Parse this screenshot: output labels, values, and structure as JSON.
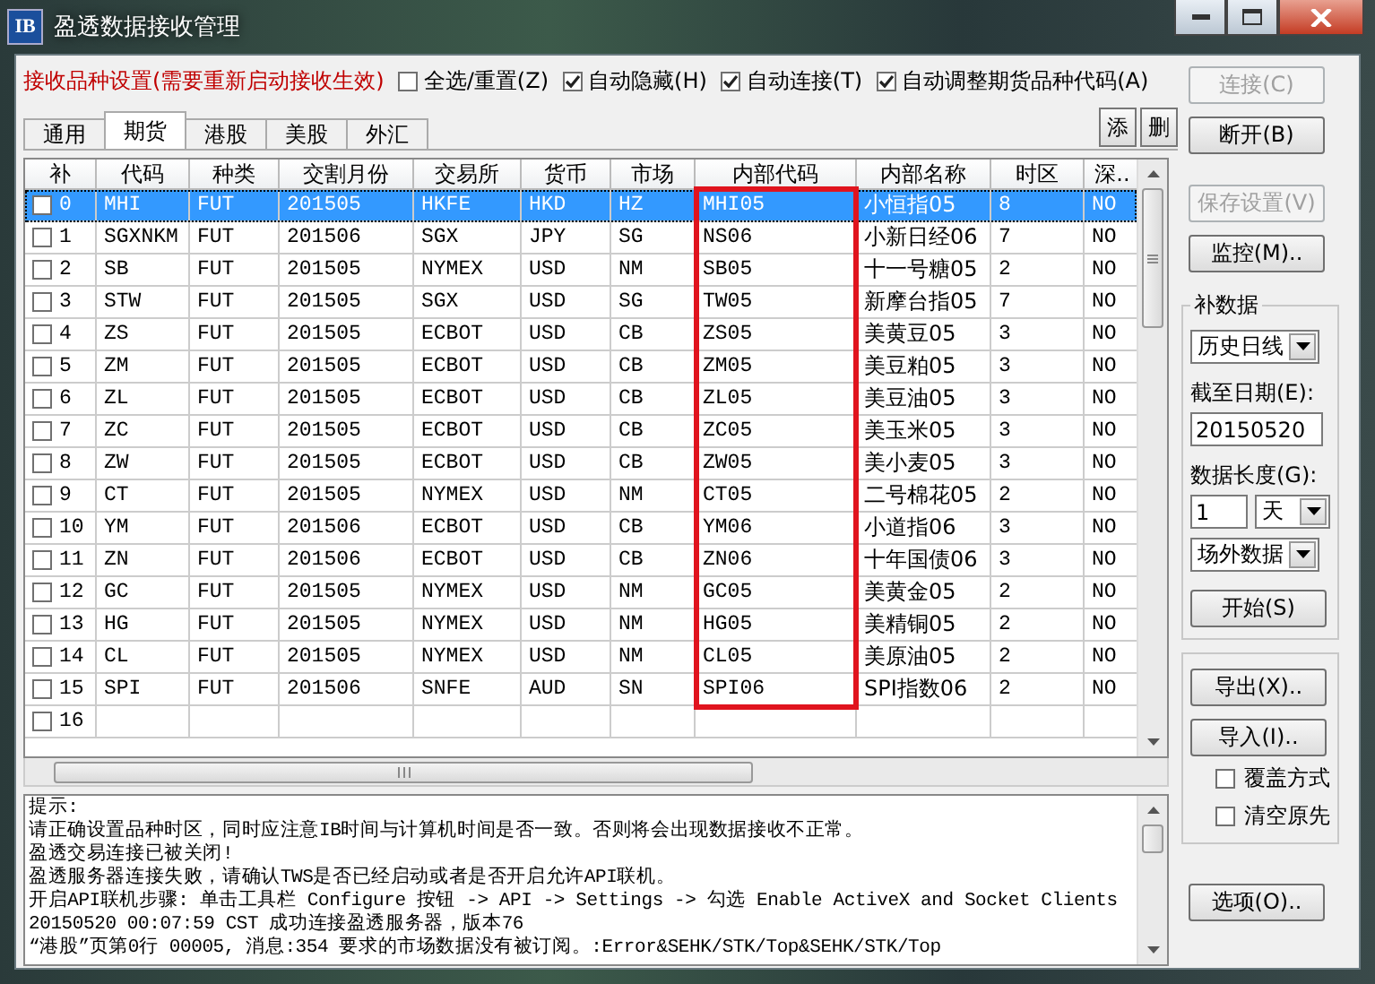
{
  "window": {
    "title": "盈透数据接收管理",
    "icon_text": "IB"
  },
  "settings": {
    "title": "接收品种设置(需要重新启动接收生效)",
    "options": [
      {
        "label": "全选/重置(Z)",
        "checked": false
      },
      {
        "label": "自动隐藏(H)",
        "checked": true
      },
      {
        "label": "自动连接(T)",
        "checked": true
      },
      {
        "label": "自动调整期货品种代码(A)",
        "checked": true
      }
    ]
  },
  "tabs": [
    {
      "label": "通用",
      "selected": false
    },
    {
      "label": "期货",
      "selected": true
    },
    {
      "label": "港股",
      "selected": false
    },
    {
      "label": "美股",
      "selected": false
    },
    {
      "label": "外汇",
      "selected": false
    }
  ],
  "tab_buttons": [
    "添",
    "删"
  ],
  "table": {
    "columns": [
      {
        "label": "补",
        "highlighted": false
      },
      {
        "label": "代码",
        "highlighted": false
      },
      {
        "label": "种类",
        "highlighted": false
      },
      {
        "label": "交割月份",
        "highlighted": false
      },
      {
        "label": "交易所",
        "highlighted": false
      },
      {
        "label": "货币",
        "highlighted": false
      },
      {
        "label": "市场",
        "highlighted": false
      },
      {
        "label": "内部代码",
        "highlighted": true
      },
      {
        "label": "内部名称",
        "highlighted": false
      },
      {
        "label": "时区",
        "highlighted": false
      },
      {
        "label": "深..",
        "highlighted": false
      }
    ],
    "rows": [
      {
        "checked": false,
        "selected": true,
        "cells": [
          "0",
          "MHI",
          "FUT",
          "201505",
          "HKFE",
          "HKD",
          "HZ",
          "MHI05",
          "小恒指05",
          "8",
          "NO"
        ]
      },
      {
        "checked": false,
        "selected": false,
        "cells": [
          "1",
          "SGXNKM",
          "FUT",
          "201506",
          "SGX",
          "JPY",
          "SG",
          "NS06",
          "小新日经06",
          "7",
          "NO"
        ]
      },
      {
        "checked": false,
        "selected": false,
        "cells": [
          "2",
          "SB",
          "FUT",
          "201505",
          "NYMEX",
          "USD",
          "NM",
          "SB05",
          "十一号糖05",
          "2",
          "NO"
        ]
      },
      {
        "checked": false,
        "selected": false,
        "cells": [
          "3",
          "STW",
          "FUT",
          "201505",
          "SGX",
          "USD",
          "SG",
          "TW05",
          "新摩台指05",
          "7",
          "NO"
        ]
      },
      {
        "checked": false,
        "selected": false,
        "cells": [
          "4",
          "ZS",
          "FUT",
          "201505",
          "ECBOT",
          "USD",
          "CB",
          "ZS05",
          "美黄豆05",
          "3",
          "NO"
        ]
      },
      {
        "checked": false,
        "selected": false,
        "cells": [
          "5",
          "ZM",
          "FUT",
          "201505",
          "ECBOT",
          "USD",
          "CB",
          "ZM05",
          "美豆粕05",
          "3",
          "NO"
        ]
      },
      {
        "checked": false,
        "selected": false,
        "cells": [
          "6",
          "ZL",
          "FUT",
          "201505",
          "ECBOT",
          "USD",
          "CB",
          "ZL05",
          "美豆油05",
          "3",
          "NO"
        ]
      },
      {
        "checked": false,
        "selected": false,
        "cells": [
          "7",
          "ZC",
          "FUT",
          "201505",
          "ECBOT",
          "USD",
          "CB",
          "ZC05",
          "美玉米05",
          "3",
          "NO"
        ]
      },
      {
        "checked": false,
        "selected": false,
        "cells": [
          "8",
          "ZW",
          "FUT",
          "201505",
          "ECBOT",
          "USD",
          "CB",
          "ZW05",
          "美小麦05",
          "3",
          "NO"
        ]
      },
      {
        "checked": false,
        "selected": false,
        "cells": [
          "9",
          "CT",
          "FUT",
          "201505",
          "NYMEX",
          "USD",
          "NM",
          "CT05",
          "二号棉花05",
          "2",
          "NO"
        ]
      },
      {
        "checked": false,
        "selected": false,
        "cells": [
          "10",
          "YM",
          "FUT",
          "201506",
          "ECBOT",
          "USD",
          "CB",
          "YM06",
          "小道指06",
          "3",
          "NO"
        ]
      },
      {
        "checked": false,
        "selected": false,
        "cells": [
          "11",
          "ZN",
          "FUT",
          "201506",
          "ECBOT",
          "USD",
          "CB",
          "ZN06",
          "十年国债06",
          "3",
          "NO"
        ]
      },
      {
        "checked": false,
        "selected": false,
        "cells": [
          "12",
          "GC",
          "FUT",
          "201505",
          "NYMEX",
          "USD",
          "NM",
          "GC05",
          "美黄金05",
          "2",
          "NO"
        ]
      },
      {
        "checked": false,
        "selected": false,
        "cells": [
          "13",
          "HG",
          "FUT",
          "201505",
          "NYMEX",
          "USD",
          "NM",
          "HG05",
          "美精铜05",
          "2",
          "NO"
        ]
      },
      {
        "checked": false,
        "selected": false,
        "cells": [
          "14",
          "CL",
          "FUT",
          "201505",
          "NYMEX",
          "USD",
          "NM",
          "CL05",
          "美原油05",
          "2",
          "NO"
        ]
      },
      {
        "checked": false,
        "selected": false,
        "cells": [
          "15",
          "SPI",
          "FUT",
          "201506",
          "SNFE",
          "AUD",
          "SN",
          "SPI06",
          "SPI指数06",
          "2",
          "NO"
        ]
      },
      {
        "checked": false,
        "selected": false,
        "cells": [
          "16"
        ]
      }
    ]
  },
  "log": {
    "lines": [
      "提示:",
      "请正确设置品种时区，同时应注意IB时间与计算机时间是否一致。否则将会出现数据接收不正常。",
      "盈透交易连接已被关闭!",
      "盈透服务器连接失败，请确认TWS是否已经启动或者是否开启允许API联机。",
      "开启API联机步骤: 单击工具栏 Configure 按钮 -> API -> Settings -> 勾选 Enable ActiveX and Socket Clients",
      "20150520 00:07:59 CST 成功连接盈透服务器，版本76",
      "“港股”页第0行 00005, 消息:354 要求的市场数据没有被订阅。:Error&SEHK/STK/Top&SEHK/STK/Top"
    ]
  },
  "side": {
    "connect": {
      "label": "连接(C)",
      "disabled": true
    },
    "disconnect": {
      "label": "断开(B)",
      "disabled": false
    },
    "save": {
      "label": "保存设置(V)",
      "disabled": true
    },
    "monitor": {
      "label": "监控(M)..",
      "disabled": false
    },
    "backfill": {
      "title": "补数据",
      "period": "历史日线",
      "date_label": "截至日期(E):",
      "date_value": "20150520",
      "length_label": "数据长度(G):",
      "length_value": "1",
      "unit": "天",
      "source": "场外数据",
      "start": {
        "label": "开始(S)",
        "disabled": false
      }
    },
    "export": {
      "label": "导出(X)..",
      "disabled": false
    },
    "import": {
      "label": "导入(I)..",
      "disabled": false
    },
    "import_options": [
      {
        "label": "覆盖方式",
        "checked": false
      },
      {
        "label": "清空原先",
        "checked": false
      }
    ],
    "options": {
      "label": "选项(O)..",
      "disabled": false
    }
  }
}
